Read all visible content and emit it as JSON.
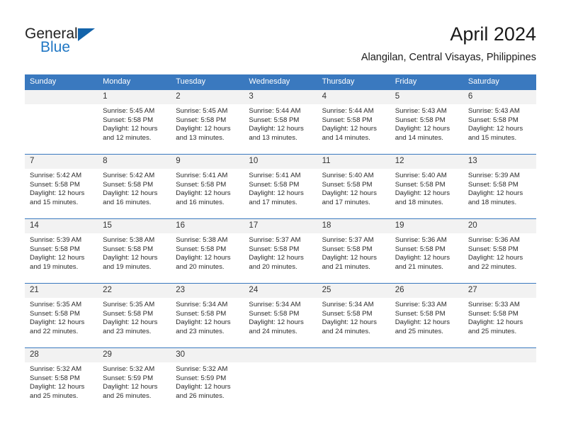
{
  "brand": {
    "name_top": "General",
    "name_bottom": "Blue",
    "color_dark": "#232323",
    "color_blue": "#2077C4",
    "triangle_color": "#1363AA"
  },
  "header": {
    "title": "April 2024",
    "subtitle": "Alangilan, Central Visayas, Philippines"
  },
  "theme": {
    "header_bg": "#3A79BF",
    "daynum_bg": "#F2F2F2",
    "grid_line": "#3A79BF",
    "text": "#2b2b2b"
  },
  "weekdays": [
    "Sunday",
    "Monday",
    "Tuesday",
    "Wednesday",
    "Thursday",
    "Friday",
    "Saturday"
  ],
  "labels": {
    "sunrise": "Sunrise:",
    "sunset": "Sunset:",
    "daylight": "Daylight:"
  },
  "weeks": [
    [
      {
        "day": "",
        "sunrise": "",
        "sunset": "",
        "daylight_line1": "",
        "daylight_line2": "",
        "blank": true
      },
      {
        "day": "1",
        "sunrise": "Sunrise: 5:45 AM",
        "sunset": "Sunset: 5:58 PM",
        "daylight_line1": "Daylight: 12 hours",
        "daylight_line2": "and 12 minutes."
      },
      {
        "day": "2",
        "sunrise": "Sunrise: 5:45 AM",
        "sunset": "Sunset: 5:58 PM",
        "daylight_line1": "Daylight: 12 hours",
        "daylight_line2": "and 13 minutes."
      },
      {
        "day": "3",
        "sunrise": "Sunrise: 5:44 AM",
        "sunset": "Sunset: 5:58 PM",
        "daylight_line1": "Daylight: 12 hours",
        "daylight_line2": "and 13 minutes."
      },
      {
        "day": "4",
        "sunrise": "Sunrise: 5:44 AM",
        "sunset": "Sunset: 5:58 PM",
        "daylight_line1": "Daylight: 12 hours",
        "daylight_line2": "and 14 minutes."
      },
      {
        "day": "5",
        "sunrise": "Sunrise: 5:43 AM",
        "sunset": "Sunset: 5:58 PM",
        "daylight_line1": "Daylight: 12 hours",
        "daylight_line2": "and 14 minutes."
      },
      {
        "day": "6",
        "sunrise": "Sunrise: 5:43 AM",
        "sunset": "Sunset: 5:58 PM",
        "daylight_line1": "Daylight: 12 hours",
        "daylight_line2": "and 15 minutes."
      }
    ],
    [
      {
        "day": "7",
        "sunrise": "Sunrise: 5:42 AM",
        "sunset": "Sunset: 5:58 PM",
        "daylight_line1": "Daylight: 12 hours",
        "daylight_line2": "and 15 minutes."
      },
      {
        "day": "8",
        "sunrise": "Sunrise: 5:42 AM",
        "sunset": "Sunset: 5:58 PM",
        "daylight_line1": "Daylight: 12 hours",
        "daylight_line2": "and 16 minutes."
      },
      {
        "day": "9",
        "sunrise": "Sunrise: 5:41 AM",
        "sunset": "Sunset: 5:58 PM",
        "daylight_line1": "Daylight: 12 hours",
        "daylight_line2": "and 16 minutes."
      },
      {
        "day": "10",
        "sunrise": "Sunrise: 5:41 AM",
        "sunset": "Sunset: 5:58 PM",
        "daylight_line1": "Daylight: 12 hours",
        "daylight_line2": "and 17 minutes."
      },
      {
        "day": "11",
        "sunrise": "Sunrise: 5:40 AM",
        "sunset": "Sunset: 5:58 PM",
        "daylight_line1": "Daylight: 12 hours",
        "daylight_line2": "and 17 minutes."
      },
      {
        "day": "12",
        "sunrise": "Sunrise: 5:40 AM",
        "sunset": "Sunset: 5:58 PM",
        "daylight_line1": "Daylight: 12 hours",
        "daylight_line2": "and 18 minutes."
      },
      {
        "day": "13",
        "sunrise": "Sunrise: 5:39 AM",
        "sunset": "Sunset: 5:58 PM",
        "daylight_line1": "Daylight: 12 hours",
        "daylight_line2": "and 18 minutes."
      }
    ],
    [
      {
        "day": "14",
        "sunrise": "Sunrise: 5:39 AM",
        "sunset": "Sunset: 5:58 PM",
        "daylight_line1": "Daylight: 12 hours",
        "daylight_line2": "and 19 minutes."
      },
      {
        "day": "15",
        "sunrise": "Sunrise: 5:38 AM",
        "sunset": "Sunset: 5:58 PM",
        "daylight_line1": "Daylight: 12 hours",
        "daylight_line2": "and 19 minutes."
      },
      {
        "day": "16",
        "sunrise": "Sunrise: 5:38 AM",
        "sunset": "Sunset: 5:58 PM",
        "daylight_line1": "Daylight: 12 hours",
        "daylight_line2": "and 20 minutes."
      },
      {
        "day": "17",
        "sunrise": "Sunrise: 5:37 AM",
        "sunset": "Sunset: 5:58 PM",
        "daylight_line1": "Daylight: 12 hours",
        "daylight_line2": "and 20 minutes."
      },
      {
        "day": "18",
        "sunrise": "Sunrise: 5:37 AM",
        "sunset": "Sunset: 5:58 PM",
        "daylight_line1": "Daylight: 12 hours",
        "daylight_line2": "and 21 minutes."
      },
      {
        "day": "19",
        "sunrise": "Sunrise: 5:36 AM",
        "sunset": "Sunset: 5:58 PM",
        "daylight_line1": "Daylight: 12 hours",
        "daylight_line2": "and 21 minutes."
      },
      {
        "day": "20",
        "sunrise": "Sunrise: 5:36 AM",
        "sunset": "Sunset: 5:58 PM",
        "daylight_line1": "Daylight: 12 hours",
        "daylight_line2": "and 22 minutes."
      }
    ],
    [
      {
        "day": "21",
        "sunrise": "Sunrise: 5:35 AM",
        "sunset": "Sunset: 5:58 PM",
        "daylight_line1": "Daylight: 12 hours",
        "daylight_line2": "and 22 minutes."
      },
      {
        "day": "22",
        "sunrise": "Sunrise: 5:35 AM",
        "sunset": "Sunset: 5:58 PM",
        "daylight_line1": "Daylight: 12 hours",
        "daylight_line2": "and 23 minutes."
      },
      {
        "day": "23",
        "sunrise": "Sunrise: 5:34 AM",
        "sunset": "Sunset: 5:58 PM",
        "daylight_line1": "Daylight: 12 hours",
        "daylight_line2": "and 23 minutes."
      },
      {
        "day": "24",
        "sunrise": "Sunrise: 5:34 AM",
        "sunset": "Sunset: 5:58 PM",
        "daylight_line1": "Daylight: 12 hours",
        "daylight_line2": "and 24 minutes."
      },
      {
        "day": "25",
        "sunrise": "Sunrise: 5:34 AM",
        "sunset": "Sunset: 5:58 PM",
        "daylight_line1": "Daylight: 12 hours",
        "daylight_line2": "and 24 minutes."
      },
      {
        "day": "26",
        "sunrise": "Sunrise: 5:33 AM",
        "sunset": "Sunset: 5:58 PM",
        "daylight_line1": "Daylight: 12 hours",
        "daylight_line2": "and 25 minutes."
      },
      {
        "day": "27",
        "sunrise": "Sunrise: 5:33 AM",
        "sunset": "Sunset: 5:58 PM",
        "daylight_line1": "Daylight: 12 hours",
        "daylight_line2": "and 25 minutes."
      }
    ],
    [
      {
        "day": "28",
        "sunrise": "Sunrise: 5:32 AM",
        "sunset": "Sunset: 5:58 PM",
        "daylight_line1": "Daylight: 12 hours",
        "daylight_line2": "and 25 minutes."
      },
      {
        "day": "29",
        "sunrise": "Sunrise: 5:32 AM",
        "sunset": "Sunset: 5:59 PM",
        "daylight_line1": "Daylight: 12 hours",
        "daylight_line2": "and 26 minutes."
      },
      {
        "day": "30",
        "sunrise": "Sunrise: 5:32 AM",
        "sunset": "Sunset: 5:59 PM",
        "daylight_line1": "Daylight: 12 hours",
        "daylight_line2": "and 26 minutes."
      },
      {
        "day": "",
        "sunrise": "",
        "sunset": "",
        "daylight_line1": "",
        "daylight_line2": "",
        "blank": true
      },
      {
        "day": "",
        "sunrise": "",
        "sunset": "",
        "daylight_line1": "",
        "daylight_line2": "",
        "blank": true
      },
      {
        "day": "",
        "sunrise": "",
        "sunset": "",
        "daylight_line1": "",
        "daylight_line2": "",
        "blank": true
      },
      {
        "day": "",
        "sunrise": "",
        "sunset": "",
        "daylight_line1": "",
        "daylight_line2": "",
        "blank": true
      }
    ]
  ]
}
